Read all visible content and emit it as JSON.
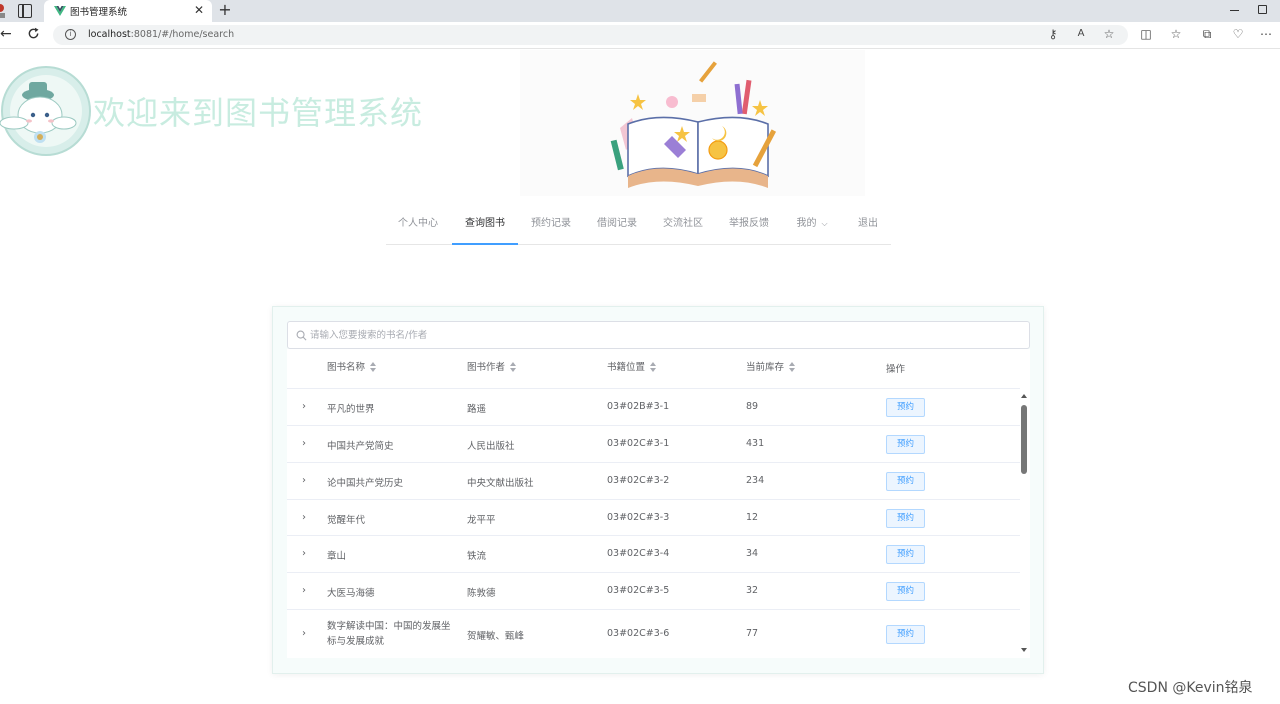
{
  "browser": {
    "tab_title": "图书管理系统",
    "url_host": "localhost",
    "url_rest": ":8081/#/home/search"
  },
  "header": {
    "welcome": "欢迎来到图书管理系统"
  },
  "menu": {
    "items": [
      "个人中心",
      "查询图书",
      "预约记录",
      "借阅记录",
      "交流社区",
      "举报反馈",
      "我的",
      "退出"
    ],
    "active": "查询图书"
  },
  "search": {
    "placeholder": "请输入您要搜索的书名/作者"
  },
  "table": {
    "columns": [
      "图书名称",
      "图书作者",
      "书籍位置",
      "当前库存",
      "操作"
    ],
    "rows": [
      {
        "name": "平凡的世界",
        "author": "路遥",
        "location": "03#02B#3-1",
        "stock": "89",
        "action": "预约"
      },
      {
        "name": "中国共产党简史",
        "author": "人民出版社",
        "location": "03#02C#3-1",
        "stock": "431",
        "action": "预约"
      },
      {
        "name": "论中国共产党历史",
        "author": "中央文献出版社",
        "location": "03#02C#3-2",
        "stock": "234",
        "action": "预约"
      },
      {
        "name": "觉醒年代",
        "author": "龙平平",
        "location": "03#02C#3-3",
        "stock": "12",
        "action": "预约"
      },
      {
        "name": "章山",
        "author": "铁流",
        "location": "03#02C#3-4",
        "stock": "34",
        "action": "预约"
      },
      {
        "name": "大医马海德",
        "author": "陈敦德",
        "location": "03#02C#3-5",
        "stock": "32",
        "action": "预约"
      },
      {
        "name": "数字解读中国：中国的发展坐标与发展成就",
        "author": "贺耀敏、甄峰",
        "location": "03#02C#3-6",
        "stock": "77",
        "action": "预约"
      }
    ]
  },
  "watermark": "CSDN @Kevin铭泉",
  "colors": {
    "accent": "#409eff",
    "welcome_text": "#c8ece0",
    "card_bg": "#f6fcfb"
  }
}
